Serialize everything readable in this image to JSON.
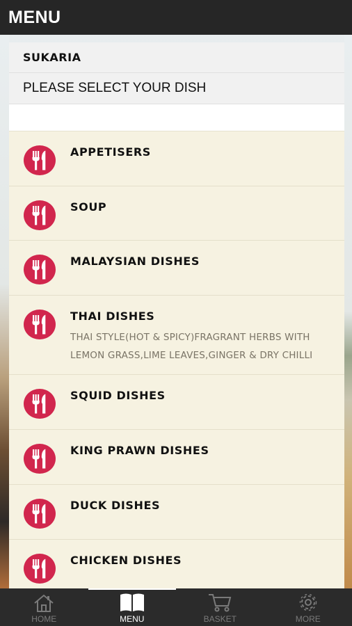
{
  "topbar": {
    "title": "MENU"
  },
  "restaurant": {
    "name": "SUKARIA",
    "prompt": "PLEASE SELECT YOUR DISH"
  },
  "categories": [
    {
      "name": "APPETISERS",
      "description": ""
    },
    {
      "name": "SOUP",
      "description": ""
    },
    {
      "name": "MALAYSIAN DISHES",
      "description": ""
    },
    {
      "name": "THAI DISHES",
      "description": "THAI STYLE(HOT & SPICY)FRAGRANT HERBS WITH LEMON GRASS,LIME LEAVES,GINGER & DRY CHILLI"
    },
    {
      "name": "SQUID DISHES",
      "description": ""
    },
    {
      "name": "KING PRAWN DISHES",
      "description": ""
    },
    {
      "name": "DUCK DISHES",
      "description": ""
    },
    {
      "name": "CHICKEN DISHES",
      "description": ""
    }
  ],
  "icons": {
    "category": "fork-knife-icon"
  },
  "colors": {
    "accent": "#d1264d",
    "header": "#262626",
    "item_bg": "#f6f2e1"
  },
  "tabs": [
    {
      "label": "HOME",
      "icon": "home-icon",
      "active": false
    },
    {
      "label": "MENU",
      "icon": "book-icon",
      "active": true
    },
    {
      "label": "BASKET",
      "icon": "cart-icon",
      "active": false
    },
    {
      "label": "MORE",
      "icon": "gear-icon",
      "active": false
    }
  ]
}
